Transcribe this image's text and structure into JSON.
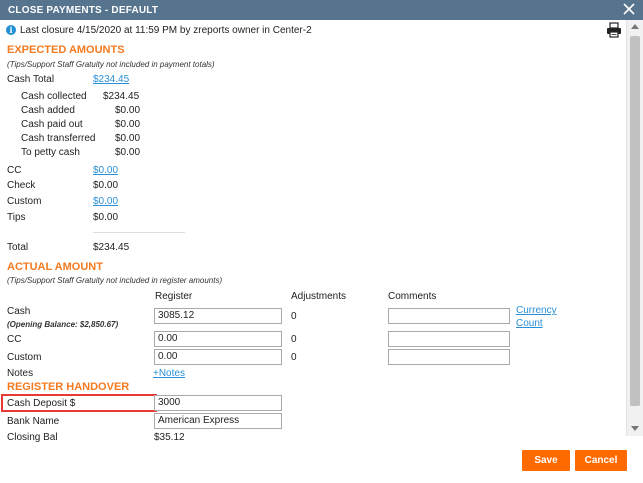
{
  "window": {
    "title": "CLOSE PAYMENTS - DEFAULT",
    "close_icon": "close-icon",
    "print_icon": "printer-icon"
  },
  "closure_info": "Last closure 4/15/2020 at 11:59 PM by zreports owner in Center-2",
  "expected": {
    "heading": "EXPECTED AMOUNTS",
    "note": "(Tips/Support Staff Gratuity not included in payment totals)",
    "cash_total_label": "Cash Total",
    "cash_total_value": "$234.45",
    "cash_breakdown": [
      {
        "label": "Cash collected",
        "value": "$234.45"
      },
      {
        "label": "Cash added",
        "value": "$0.00"
      },
      {
        "label": "Cash paid out",
        "value": "$0.00"
      },
      {
        "label": "Cash transferred",
        "value": "$0.00"
      },
      {
        "label": "To petty cash",
        "value": "$0.00"
      }
    ],
    "other": [
      {
        "label": "CC",
        "value": "$0.00",
        "link": true
      },
      {
        "label": "Check",
        "value": "$0.00",
        "link": false
      },
      {
        "label": "Custom",
        "value": "$0.00",
        "link": true
      },
      {
        "label": "Tips",
        "value": "$0.00",
        "link": false
      }
    ],
    "total_label": "Total",
    "total_value": "$234.45"
  },
  "actual": {
    "heading": "ACTUAL AMOUNT",
    "note": "(Tips/Support Staff Gratuity not included in register amounts)",
    "col_register": "Register",
    "col_adjustments": "Adjustments",
    "col_comments": "Comments",
    "rows": [
      {
        "label": "Cash",
        "register": "3085.12",
        "adjustment": "0",
        "comment": ""
      },
      {
        "label": "CC",
        "register": "0.00",
        "adjustment": "0",
        "comment": ""
      },
      {
        "label": "Custom",
        "register": "0.00",
        "adjustment": "0",
        "comment": ""
      }
    ],
    "opening_balance": "(Opening Balance: $2,850.67)",
    "currency_link_1": "Currency",
    "currency_link_2": "Count",
    "notes_label": "Notes",
    "notes_link": "+Notes"
  },
  "handover": {
    "heading": "REGISTER HANDOVER",
    "cash_deposit_label": "Cash Deposit $",
    "cash_deposit_value": "3000",
    "bank_name_label": "Bank Name",
    "bank_name_value": "American Express",
    "cut_label": "Closing Bal",
    "cut_value": "$35.12"
  },
  "buttons": {
    "save": "Save",
    "cancel": "Cancel"
  },
  "colors": {
    "titlebar": "#57748f",
    "accent": "#f47a20",
    "button": "#ff6a00",
    "link": "#2a8fd6",
    "highlight": "#e53935"
  }
}
